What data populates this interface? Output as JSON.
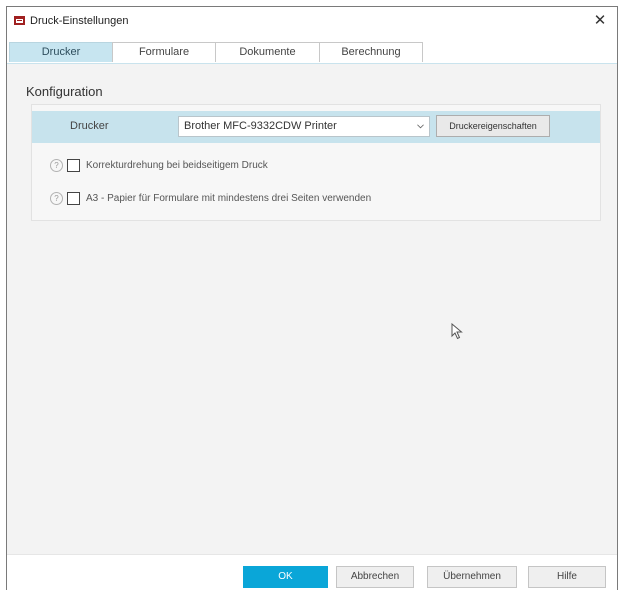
{
  "window": {
    "title": "Druck-Einstellungen",
    "close_glyph": "✕"
  },
  "tabs": [
    {
      "label": "Drucker",
      "active": true
    },
    {
      "label": "Formulare",
      "active": false
    },
    {
      "label": "Dokumente",
      "active": false
    },
    {
      "label": "Berechnung",
      "active": false
    }
  ],
  "config": {
    "section_title": "Konfiguration",
    "printer_label": "Drucker",
    "printer_value": "Brother MFC-9332CDW Printer",
    "properties_button": "Druckereigenschaften",
    "options": [
      {
        "label": "Korrekturdrehung bei beidseitigem Druck",
        "checked": false,
        "help_glyph": "?"
      },
      {
        "label": "A3 - Papier für Formulare mit mindestens drei Seiten verwenden",
        "checked": false,
        "help_glyph": "?"
      }
    ]
  },
  "footer": {
    "ok": "OK",
    "cancel": "Abbrechen",
    "apply": "Übernehmen",
    "help": "Hilfe"
  },
  "colors": {
    "accent": "#0aa6d8",
    "tab_active": "#c7e5f0",
    "printer_row": "#c7e3ed",
    "app_icon": "#a02020"
  },
  "icons": [
    "app-icon",
    "close-icon",
    "chevron-down-icon",
    "help-icon",
    "mouse-cursor-icon"
  ]
}
